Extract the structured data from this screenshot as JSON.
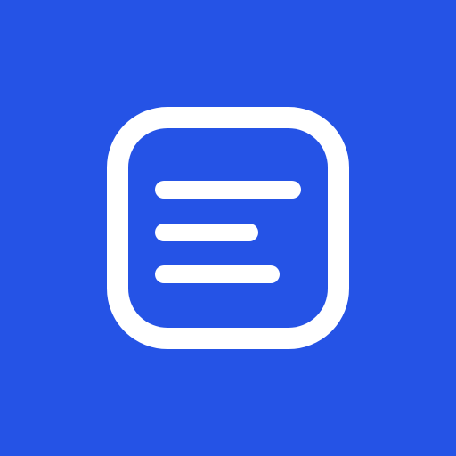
{
  "icon": {
    "name": "document-lines-icon",
    "description_hidden": "",
    "background_color": "#2553E6",
    "foreground_color": "#FFFFFF",
    "line_count": 3
  }
}
